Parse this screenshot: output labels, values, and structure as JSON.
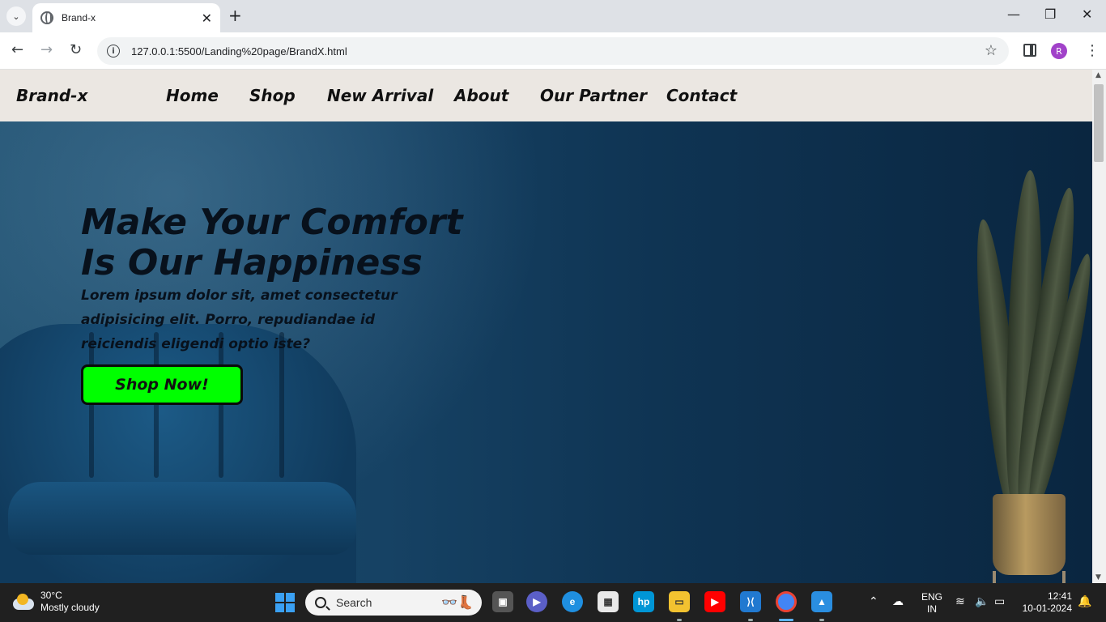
{
  "browser": {
    "tab_title": "Brand-x",
    "url": "127.0.0.1:5500/Landing%20page/BrandX.html",
    "profile_initial": "R"
  },
  "site": {
    "brand": "Brand-x",
    "nav": [
      "Home",
      "Shop",
      "New Arrival",
      "About",
      "Our Partner",
      "Contact"
    ],
    "hero": {
      "headline": "Make Your Comfort Is Our Happiness",
      "body": "Lorem ipsum dolor sit, amet consectetur adipisicing elit. Porro, repudiandae id reiciendis eligendi optio iste?",
      "cta": "Shop Now!",
      "cta_color": "#00ff00"
    }
  },
  "taskbar": {
    "weather_temp": "30°C",
    "weather_desc": "Mostly cloudy",
    "search_placeholder": "Search",
    "lang": "ENG",
    "region": "IN",
    "time": "12:41",
    "date": "10-01-2024"
  }
}
